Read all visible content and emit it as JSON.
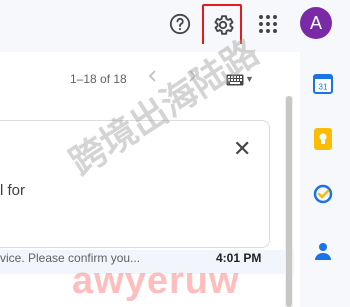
{
  "header": {
    "avatar_letter": "A",
    "help_icon": "help-circle-icon",
    "settings_icon": "gear-icon",
    "apps_icon": "apps-grid-icon"
  },
  "toolbar": {
    "count": "1–18 of 18",
    "prev_icon": "chevron-left-icon",
    "next_icon": "chevron-right-icon",
    "input_tools_icon": "keyboard-icon"
  },
  "card": {
    "text": "l for",
    "close_glyph": "✕"
  },
  "email_row": {
    "snippet": "vice. Please confirm you...",
    "time": "4:01 PM"
  },
  "side_panel": {
    "items": [
      "calendar-icon",
      "keep-icon",
      "tasks-icon",
      "contacts-icon"
    ],
    "calendar_day": "31"
  },
  "watermarks": {
    "cn": "跨境出海陆路",
    "en": "awyeruw"
  },
  "colors": {
    "avatar": "#7b2aa6",
    "highlight_frame": "#e31b1b",
    "calendar": "#1a73e8",
    "keep": "#fbbc04",
    "tasks": "#1a73e8",
    "contacts": "#1a73e8"
  }
}
